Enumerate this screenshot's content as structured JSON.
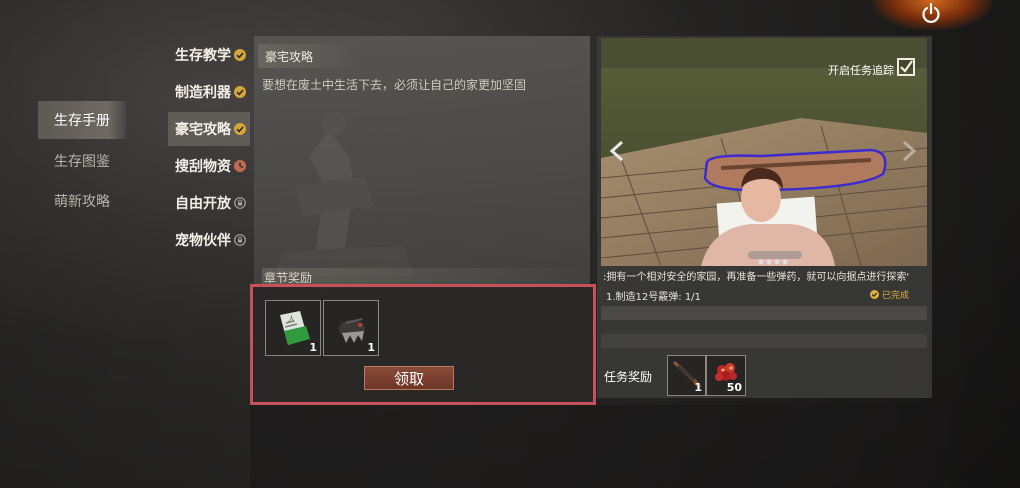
{
  "power": {
    "icon": "power-icon"
  },
  "categories": [
    {
      "label": "生存手册",
      "active": true
    },
    {
      "label": "生存图鉴",
      "active": false
    },
    {
      "label": "萌新攻略",
      "active": false
    }
  ],
  "subcategories": [
    {
      "label": "生存教学",
      "status": "completed",
      "status_icon": "check-icon"
    },
    {
      "label": "制造利器",
      "status": "completed",
      "status_icon": "check-icon"
    },
    {
      "label": "豪宅攻略",
      "status": "completed",
      "status_icon": "check-icon",
      "active": true
    },
    {
      "label": "搜刮物资",
      "status": "in-progress",
      "status_icon": "progress-icon"
    },
    {
      "label": "自由开放",
      "status": "locked",
      "status_icon": "lock-icon"
    },
    {
      "label": "宠物伙伴",
      "status": "locked",
      "status_icon": "lock-icon"
    }
  ],
  "guide": {
    "title": "豪宅攻略",
    "description": "要想在废土中生活下去，必须让自己的家更加坚固",
    "rewards_header": "章节奖励",
    "rewards": [
      {
        "icon": "blueprint-book-icon",
        "qty": "1"
      },
      {
        "icon": "helmet-armor-icon",
        "qty": "1"
      }
    ],
    "claim_label": "领取"
  },
  "quest": {
    "track_label": "开启任务追踪",
    "track_checked": true,
    "description": ":拥有一个相对安全的家园，再准备一些弹药，就可以向据点进行探索'",
    "progress": "1.制造12号霰弹: 1/1",
    "done_label": "已完成",
    "task_reward_label": "任务奖励",
    "rewards": [
      {
        "icon": "rifle-icon",
        "qty": "1"
      },
      {
        "icon": "ammo-pile-icon",
        "qty": "50"
      }
    ]
  },
  "colors": {
    "accent_check": "#d4a53a",
    "highlight_border": "#c8505a",
    "claim_button": "#7a3e30",
    "done": "#e0b040"
  }
}
